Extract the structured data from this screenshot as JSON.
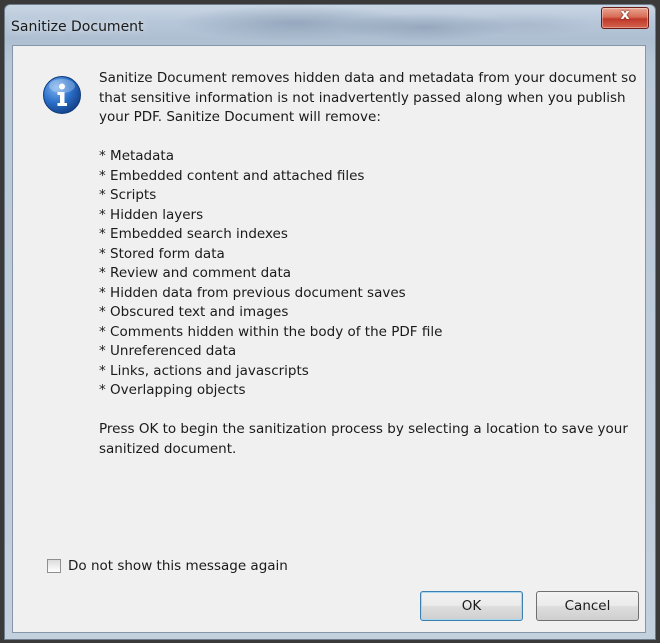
{
  "window": {
    "title": "Sanitize Document",
    "close_label": "x"
  },
  "message": {
    "intro": "Sanitize Document removes hidden data and metadata from your document so that sensitive information is not inadvertently passed along when you publish your PDF. Sanitize Document will remove:",
    "items": [
      "* Metadata",
      "* Embedded content and attached files",
      "* Scripts",
      "* Hidden layers",
      "* Embedded search indexes",
      "* Stored form data",
      "* Review and comment data",
      "* Hidden data from previous document saves",
      "* Obscured text and images",
      "* Comments hidden within the body of the PDF file",
      "* Unreferenced data",
      "* Links, actions and javascripts",
      "* Overlapping objects"
    ],
    "outro": "Press OK to begin the sanitization process by selecting a location to save your sanitized document."
  },
  "icon": "info-icon",
  "checkbox": {
    "label": "Do not show this message again",
    "checked": false
  },
  "buttons": {
    "ok_label": "OK",
    "cancel_label": "Cancel"
  }
}
